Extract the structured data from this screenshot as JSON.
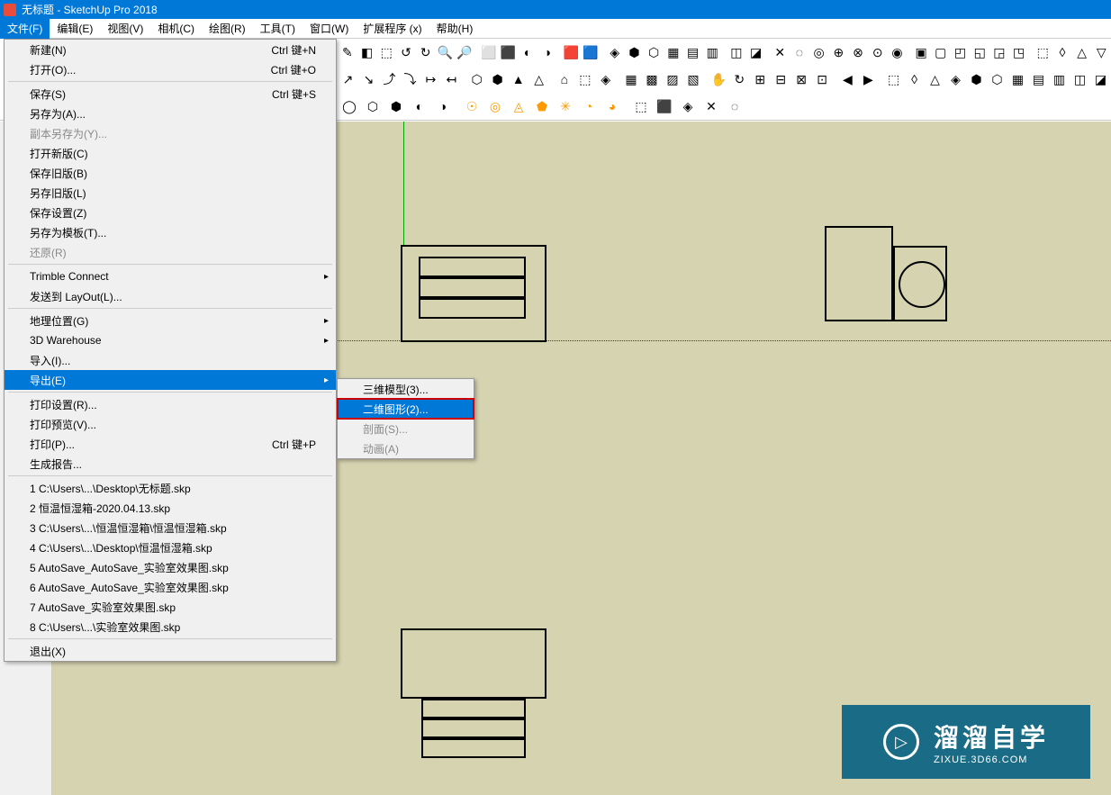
{
  "title": "无标题 - SketchUp Pro 2018",
  "menubar": [
    "文件(F)",
    "编辑(E)",
    "视图(V)",
    "相机(C)",
    "绘图(R)",
    "工具(T)",
    "窗口(W)",
    "扩展程序 (x)",
    "帮助(H)"
  ],
  "file_menu": {
    "groups": [
      [
        {
          "l": "新建(N)",
          "s": "Ctrl 键+N"
        },
        {
          "l": "打开(O)...",
          "s": "Ctrl 键+O"
        }
      ],
      [
        {
          "l": "保存(S)",
          "s": "Ctrl 键+S"
        },
        {
          "l": "另存为(A)..."
        },
        {
          "l": "副本另存为(Y)...",
          "d": true
        },
        {
          "l": "打开新版(C)"
        },
        {
          "l": "保存旧版(B)"
        },
        {
          "l": "另存旧版(L)"
        },
        {
          "l": "保存设置(Z)"
        },
        {
          "l": "另存为模板(T)..."
        },
        {
          "l": "还原(R)",
          "d": true
        }
      ],
      [
        {
          "l": "Trimble Connect",
          "a": true
        },
        {
          "l": "发送到 LayOut(L)..."
        }
      ],
      [
        {
          "l": "地理位置(G)",
          "a": true
        },
        {
          "l": "3D Warehouse",
          "a": true
        },
        {
          "l": "导入(I)..."
        },
        {
          "l": "导出(E)",
          "a": true,
          "hl": true
        }
      ],
      [
        {
          "l": "打印设置(R)..."
        },
        {
          "l": "打印预览(V)..."
        },
        {
          "l": "打印(P)...",
          "s": "Ctrl 键+P"
        },
        {
          "l": "生成报告..."
        }
      ],
      [
        {
          "l": "1 C:\\Users\\...\\Desktop\\无标题.skp"
        },
        {
          "l": "2 恒温恒湿箱-2020.04.13.skp"
        },
        {
          "l": "3 C:\\Users\\...\\恒温恒湿箱\\恒温恒湿箱.skp"
        },
        {
          "l": "4 C:\\Users\\...\\Desktop\\恒温恒湿箱.skp"
        },
        {
          "l": "5 AutoSave_AutoSave_实验室效果图.skp"
        },
        {
          "l": "6 AutoSave_AutoSave_实验室效果图.skp"
        },
        {
          "l": "7 AutoSave_实验室效果图.skp"
        },
        {
          "l": "8 C:\\Users\\...\\实验室效果图.skp"
        }
      ],
      [
        {
          "l": "退出(X)"
        }
      ]
    ]
  },
  "export_submenu": [
    {
      "l": "三维模型(3)..."
    },
    {
      "l": "二维图形(2)...",
      "sel": true
    },
    {
      "l": "剖面(S)...",
      "d": true
    },
    {
      "l": "动画(A)",
      "a": true,
      "d": true
    }
  ],
  "watermark": {
    "big": "溜溜自学",
    "small": "ZIXUE.3D66.COM"
  }
}
